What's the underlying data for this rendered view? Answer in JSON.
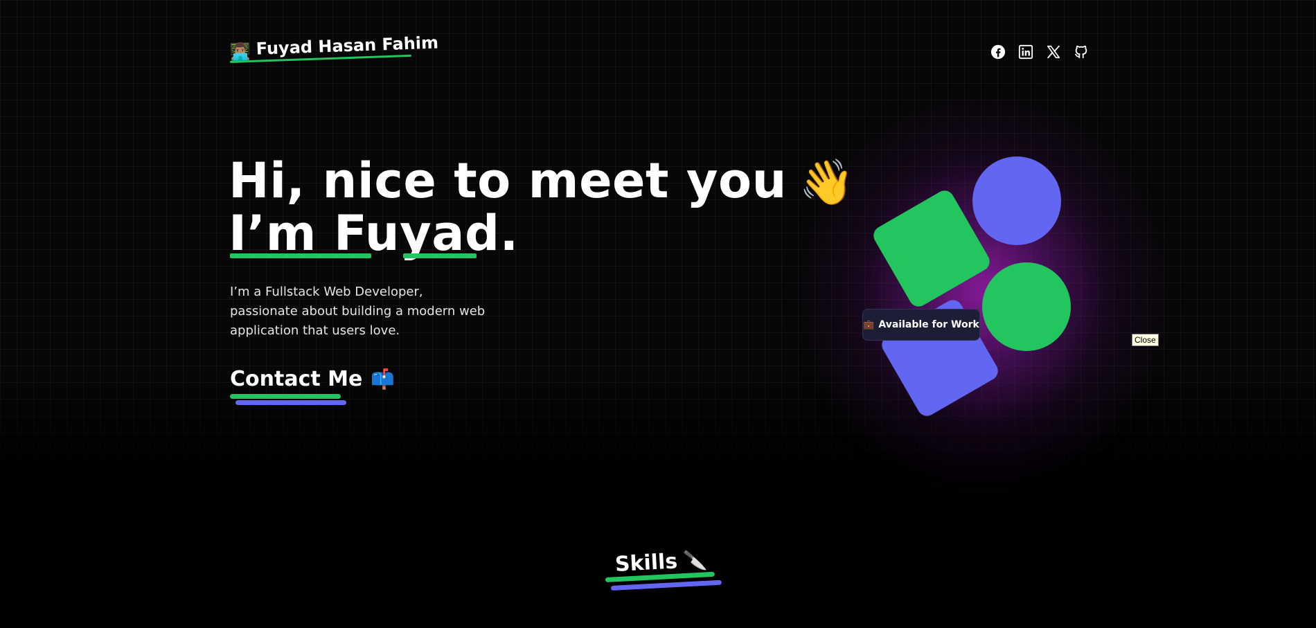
{
  "header": {
    "brand_icon": "👨🏽‍💻",
    "brand_name": "Fuyad Hasan Fahim",
    "socials": [
      {
        "name": "facebook-icon"
      },
      {
        "name": "linkedin-icon"
      },
      {
        "name": "x-icon"
      },
      {
        "name": "github-icon"
      }
    ]
  },
  "hero": {
    "line1": "Hi, nice to meet you",
    "wave_icon": "👋",
    "line2": "I’m Fuyad.",
    "description": "I’m a Fullstack Web Developer, passionate about building a modern web application that users love.",
    "contact_label": "Contact Me",
    "contact_icon": "📫"
  },
  "badge": {
    "icon": "💼",
    "label": "Available for Work"
  },
  "tooltip": {
    "label": "Close"
  },
  "skills": {
    "label": "Skills",
    "icon": "🔪"
  },
  "colors": {
    "green": "#22c55e",
    "indigo": "#6366f1",
    "background": "#000000",
    "glow": "#a01eb4"
  }
}
